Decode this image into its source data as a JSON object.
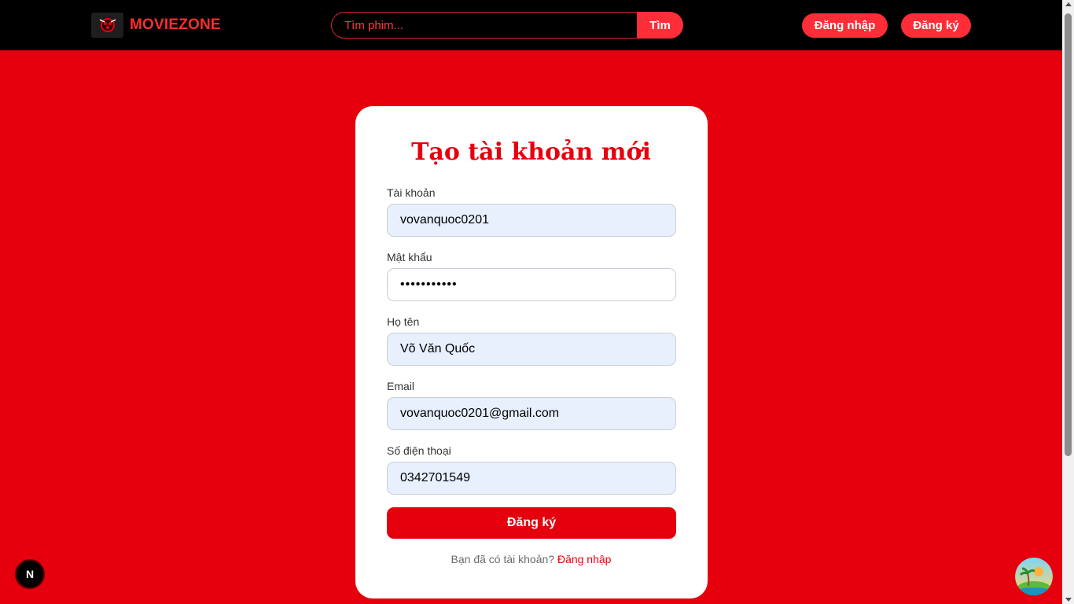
{
  "header": {
    "brand": "MOVIEZONE",
    "search": {
      "placeholder": "Tìm phim...",
      "value": "",
      "button_label": "Tìm"
    },
    "login_label": "Đăng nhập",
    "register_label": "Đăng ký"
  },
  "form": {
    "title": "Tạo tài khoản mới",
    "fields": [
      {
        "label": "Tài khoản",
        "value": "vovanquoc0201"
      },
      {
        "label": "Mật khẩu",
        "value": "•••••••••••"
      },
      {
        "label": "Họ tên",
        "value": "Võ Văn Quốc"
      },
      {
        "label": "Email",
        "value": "vovanquoc0201@gmail.com"
      },
      {
        "label": "Số điện thoại",
        "value": "0342701549"
      }
    ],
    "submit_label": "Đăng ký",
    "login_prompt": "Bạn đã có tài khoản?",
    "login_link": "Đăng nhập"
  },
  "floating": {
    "next_badge": "N"
  },
  "colors": {
    "page_bg": "#e6000d",
    "header_bg": "#000000",
    "accent": "#ff2d37",
    "input_autofill_bg": "#e8f0fe"
  },
  "icons": {
    "logo": "movie-reel-logo-icon",
    "corner_widget": "island-icon"
  }
}
